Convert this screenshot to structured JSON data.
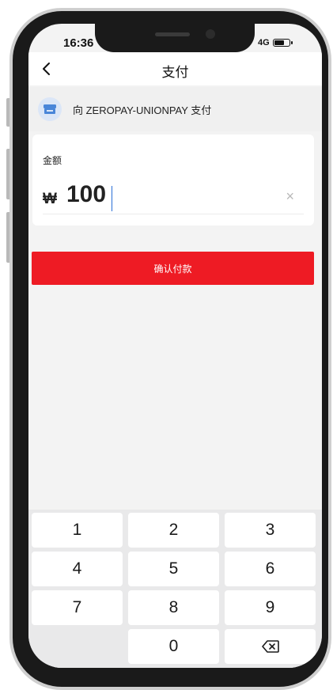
{
  "status_bar": {
    "time": "16:36",
    "network": "4G",
    "battery_level": 0.6
  },
  "nav": {
    "title": "支付",
    "back_icon": "chevron-left-icon"
  },
  "payee": {
    "text": "向 ZEROPAY-UNIONPAY 支付",
    "icon": "store-icon",
    "icon_color": "#4a86d8"
  },
  "amount": {
    "label": "金额",
    "currency": "₩",
    "value": "100",
    "clear_icon": "×"
  },
  "confirm": {
    "label": "确认付款",
    "color": "#ee1b24"
  },
  "keypad": {
    "keys": [
      "1",
      "2",
      "3",
      "4",
      "5",
      "6",
      "7",
      "8",
      "9",
      "",
      "0",
      "backspace"
    ],
    "backspace_icon": "backspace-icon"
  }
}
